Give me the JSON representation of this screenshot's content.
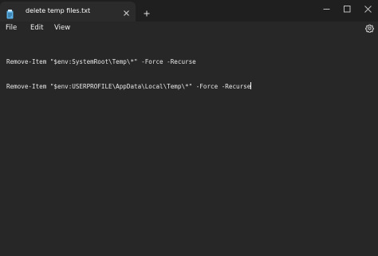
{
  "window": {
    "tab_title": "delete temp files.txt"
  },
  "icons": {
    "app": "notepad-icon",
    "close_tab": "close-icon",
    "new_tab": "plus-icon",
    "minimize": "minimize-icon",
    "maximize": "maximize-icon",
    "close_window": "close-icon",
    "settings": "gear-icon"
  },
  "menu": {
    "file": "File",
    "edit": "Edit",
    "view": "View"
  },
  "editor": {
    "lines": [
      "Remove-Item \"$env:SystemRoot\\Temp\\*\" -Force -Recurse",
      "Remove-Item \"$env:USERPROFILE\\AppData\\Local\\Temp\\*\" -Force -Recurse"
    ]
  },
  "colors": {
    "background": "#272727",
    "titlebar": "#1f1f1f",
    "active_tab": "#2b2b2b",
    "accent_icon": "#5ab0e6",
    "text": "#e8e8e8"
  }
}
